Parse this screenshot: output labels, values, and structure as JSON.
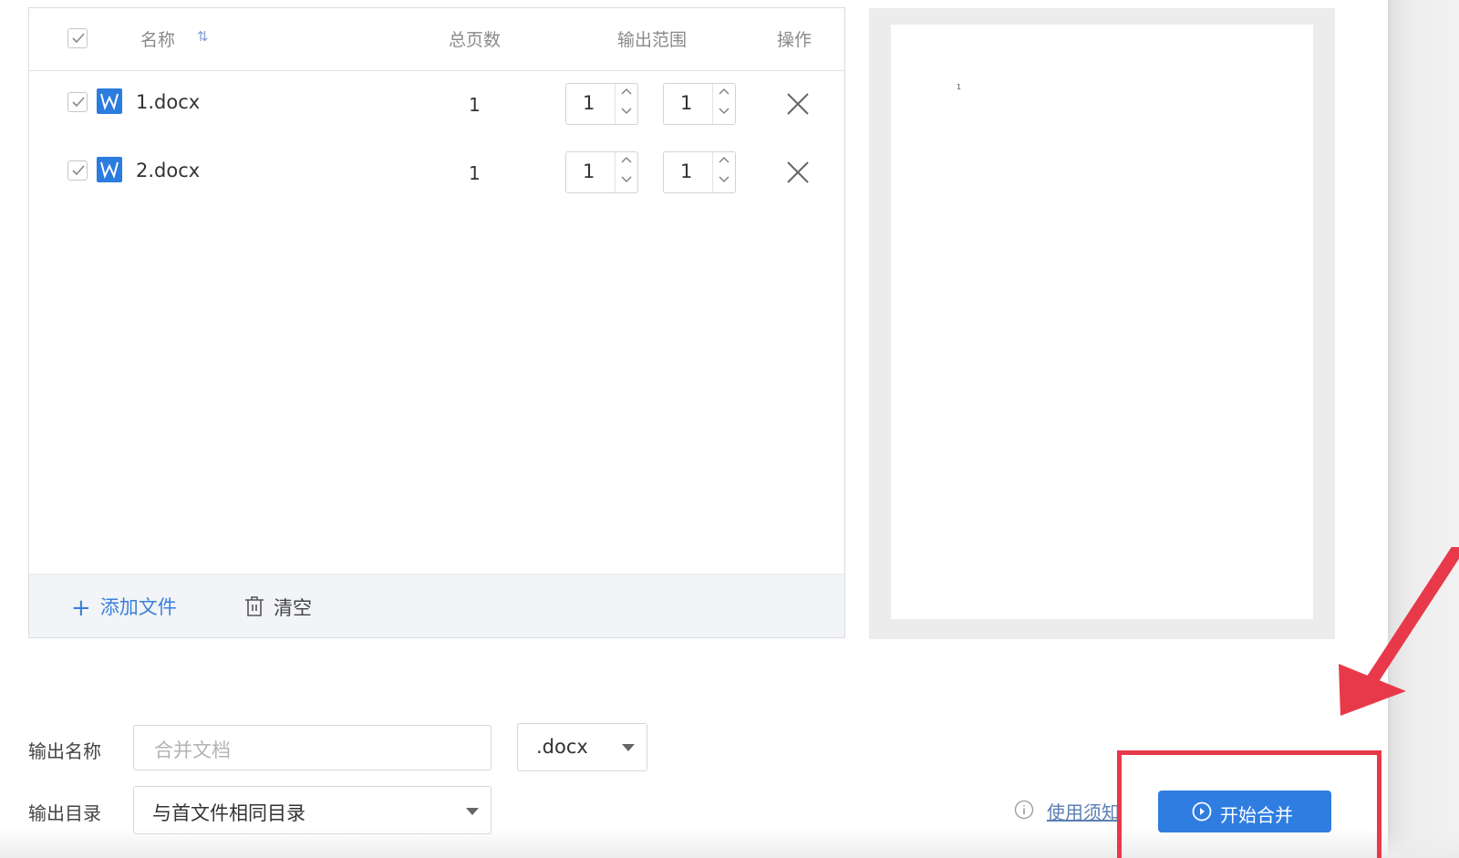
{
  "table": {
    "headers": {
      "name": "名称",
      "sort_icon": "⇅",
      "total_pages": "总页数",
      "output_range": "输出范围",
      "actions": "操作"
    },
    "rows": [
      {
        "checked": true,
        "icon": "word-icon",
        "name": "1.docx",
        "pages": "1",
        "range_start": "1",
        "range_end": "1"
      },
      {
        "checked": true,
        "icon": "word-icon",
        "name": "2.docx",
        "pages": "1",
        "range_start": "1",
        "range_end": "1"
      }
    ]
  },
  "footer": {
    "add_file": "添加文件",
    "clear": "清空"
  },
  "preview": {
    "page_number": "1"
  },
  "form": {
    "output_name_label": "输出名称",
    "output_name_placeholder": "合并文档",
    "format_value": ".docx",
    "output_dir_label": "输出目录",
    "output_dir_value": "与首文件相同目录"
  },
  "bottom": {
    "notice_link": "使用须知",
    "start_button": "开始合并"
  },
  "colors": {
    "accent": "#2f7de1",
    "highlight": "#e8394a",
    "word_icon": "#2b7cdf"
  }
}
